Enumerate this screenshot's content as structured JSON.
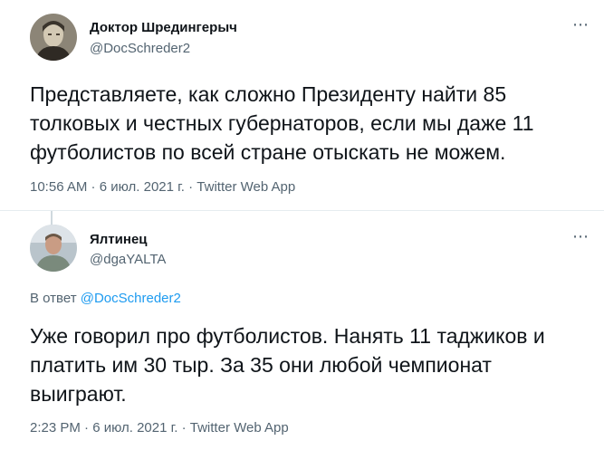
{
  "tweets": [
    {
      "display_name": "Доктор Шредингерыч",
      "handle": "@DocSchreder2",
      "text": "Представляете, как сложно Президенту найти 85 толковых и честных губернаторов, если мы даже 11 футболистов по всей стране отыскать не можем.",
      "timestamp": "10:56 AM · 6 июл. 2021 г. · Twitter Web App",
      "more_icon": "⋯"
    },
    {
      "display_name": "Ялтинец",
      "handle": "@dgaYALTA",
      "reply_prefix": "В ответ ",
      "reply_handle": "@DocSchreder2",
      "text": "Уже говорил про футболистов. Нанять 11 таджиков и платить им 30 тыр. За 35 они любой чемпионат выиграют.",
      "timestamp": "2:23 PM · 6 июл. 2021 г. · Twitter Web App",
      "more_icon": "⋯"
    }
  ],
  "colors": {
    "text": "#0f1419",
    "secondary": "#536471",
    "link": "#1d9bf0",
    "divider": "#e6ecf0"
  }
}
